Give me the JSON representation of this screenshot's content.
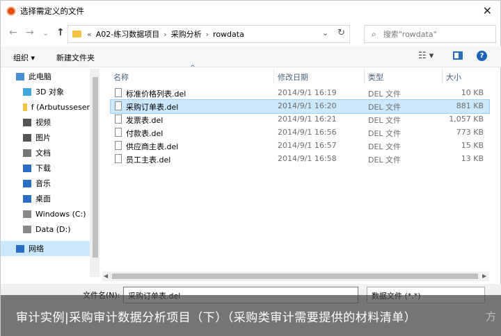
{
  "window": {
    "title": "选择需定义的文件",
    "close_glyph": "✕"
  },
  "nav": {
    "back": "←",
    "forward": "→",
    "recent": "⌄",
    "up": "↑"
  },
  "address": {
    "prefix": "«",
    "crumbs": [
      "A02-练习数据项目",
      "采购分析",
      "rowdata"
    ],
    "sep": "›",
    "dropdown": "⌄",
    "refresh": "↻"
  },
  "search": {
    "placeholder": "搜索\"rowdata\"",
    "icon": "⌕"
  },
  "toolbar": {
    "organize": "组织 ▾",
    "new_folder": "新建文件夹",
    "view_icon": "☷ ▾",
    "help": "?"
  },
  "sidebar": {
    "items": [
      {
        "label": "此电脑",
        "icon": "pc-icon",
        "color": "#4a8fd6"
      },
      {
        "label": "3D 对象",
        "icon": "cube-icon",
        "color": "#3fa7e0"
      },
      {
        "label": "f (Arbutusseser",
        "icon": "network-drive-icon",
        "color": "#f3c444"
      },
      {
        "label": "视频",
        "icon": "video-icon",
        "color": "#555555"
      },
      {
        "label": "图片",
        "icon": "picture-icon",
        "color": "#555555"
      },
      {
        "label": "文档",
        "icon": "document-icon",
        "color": "#777777"
      },
      {
        "label": "下载",
        "icon": "download-icon",
        "color": "#2b6cc4"
      },
      {
        "label": "音乐",
        "icon": "music-icon",
        "color": "#2b6cc4"
      },
      {
        "label": "桌面",
        "icon": "desktop-icon",
        "color": "#2b6cc4"
      },
      {
        "label": "Windows (C:)",
        "icon": "drive-c-icon",
        "color": "#888888"
      },
      {
        "label": "Data (D:)",
        "icon": "drive-d-icon",
        "color": "#888888"
      },
      {
        "label": "网络",
        "icon": "network-icon",
        "color": "#2b6cc4"
      }
    ]
  },
  "columns": {
    "name": "名称",
    "modified": "修改日期",
    "type": "类型",
    "size": "大小",
    "sort_glyph": "^"
  },
  "files": [
    {
      "name": "标准价格列表.del",
      "modified": "2014/9/1 16:19",
      "type": "DEL 文件",
      "size": "10 KB",
      "selected": false
    },
    {
      "name": "采购订单表.del",
      "modified": "2014/9/1 16:20",
      "type": "DEL 文件",
      "size": "881 KB",
      "selected": true
    },
    {
      "name": "发票表.del",
      "modified": "2014/9/1 16:21",
      "type": "DEL 文件",
      "size": "1,057 KB",
      "selected": false
    },
    {
      "name": "付款表.del",
      "modified": "2014/9/1 16:56",
      "type": "DEL 文件",
      "size": "773 KB",
      "selected": false
    },
    {
      "name": "供应商主表.del",
      "modified": "2014/9/1 16:57",
      "type": "DEL 文件",
      "size": "15 KB",
      "selected": false
    },
    {
      "name": "员工主表.del",
      "modified": "2014/9/1 16:58",
      "type": "DEL 文件",
      "size": "13 KB",
      "selected": false
    }
  ],
  "footer": {
    "filename_label": "文件名(N):",
    "filename_value": "采购订单表.del",
    "filetype": "数据文件 (*.*)"
  },
  "overlay": {
    "caption": "审计实例|采购审计数据分析项目（下）（采购类审计需要提供的材料清单）",
    "watermark": "方"
  }
}
